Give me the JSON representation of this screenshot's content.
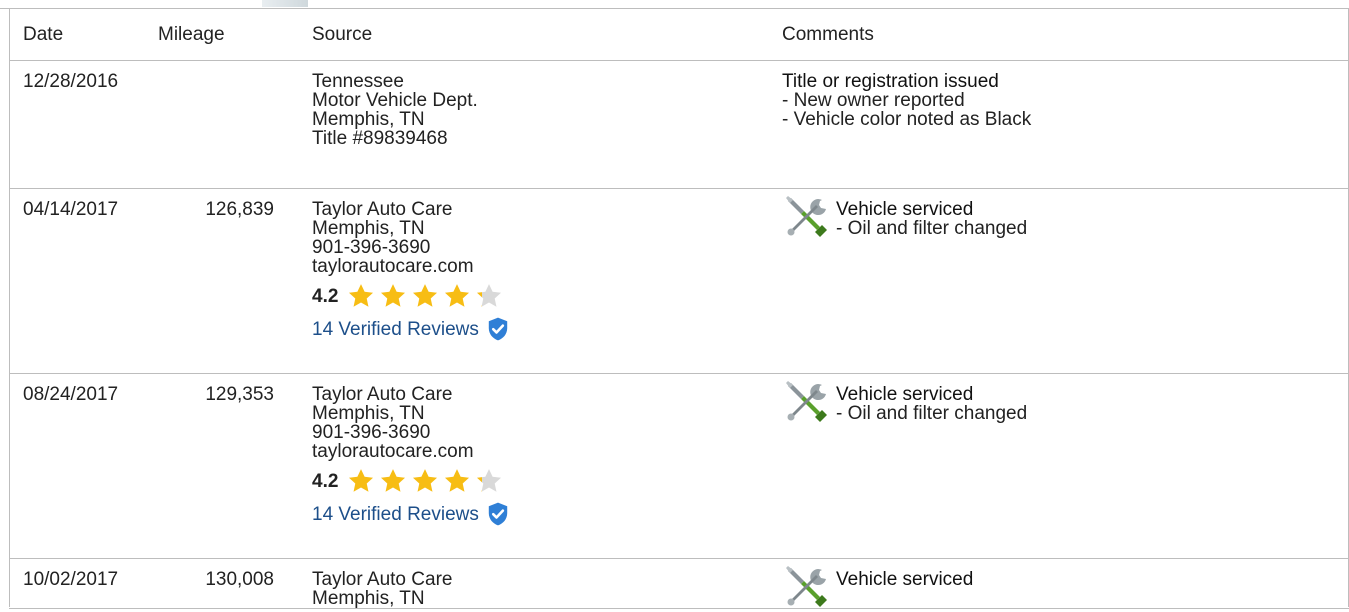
{
  "columns": {
    "date": "Date",
    "mileage": "Mileage",
    "source": "Source",
    "comments": "Comments"
  },
  "rows": [
    {
      "date": "12/28/2016",
      "mileage": "",
      "source": [
        "Tennessee",
        "Motor Vehicle Dept.",
        "Memphis, TN",
        "Title #89839468"
      ],
      "comment_icon": "",
      "comment_title": "Title or registration issued",
      "comment_lines": [
        "- New owner reported",
        "- Vehicle color noted as Black"
      ]
    },
    {
      "date": "04/14/2017",
      "mileage": "126,839",
      "source": [
        "Taylor Auto Care",
        "Memphis, TN",
        "901-396-3690",
        "taylorautocare.com"
      ],
      "rating": 4.2,
      "rating_label": "4.2",
      "reviews_label": "14 Verified Reviews",
      "comment_icon": "wrench-screwdriver-icon",
      "comment_title": "Vehicle serviced",
      "comment_lines": [
        "- Oil and filter changed"
      ]
    },
    {
      "date": "08/24/2017",
      "mileage": "129,353",
      "source": [
        "Taylor Auto Care",
        "Memphis, TN",
        "901-396-3690",
        "taylorautocare.com"
      ],
      "rating": 4.2,
      "rating_label": "4.2",
      "reviews_label": "14 Verified Reviews",
      "comment_icon": "wrench-screwdriver-icon",
      "comment_title": "Vehicle serviced",
      "comment_lines": [
        "- Oil and filter changed"
      ]
    },
    {
      "date": "10/02/2017",
      "mileage": "130,008",
      "source": [
        "Taylor Auto Care",
        "Memphis, TN"
      ],
      "comment_icon": "wrench-screwdriver-icon",
      "comment_title": "Vehicle serviced",
      "comment_lines": []
    }
  ],
  "colors": {
    "star_filled": "#f7bd14",
    "star_empty": "#d9d9d9",
    "link": "#1d4f8a",
    "verified_badge": "#2f7fd6",
    "border": "#bdbdbd"
  }
}
